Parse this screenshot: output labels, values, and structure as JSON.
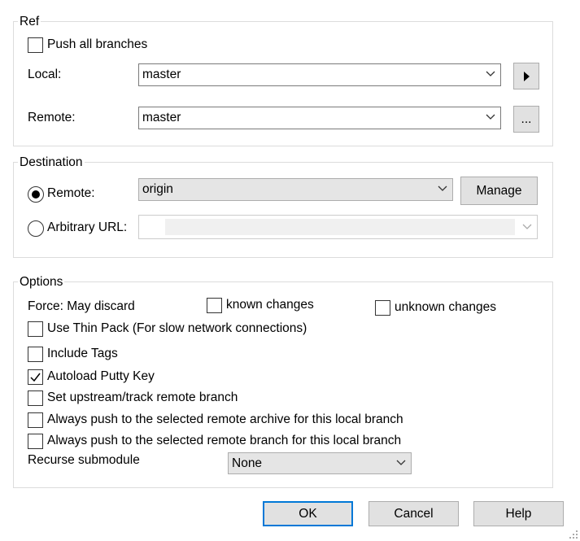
{
  "ref": {
    "legend": "Ref",
    "push_all_branches": {
      "label": "Push all branches",
      "checked": false
    },
    "local": {
      "label": "Local:",
      "value": "master",
      "button_icon": "play-triangle-icon"
    },
    "remote": {
      "label": "Remote:",
      "value": "master",
      "button_label": "..."
    }
  },
  "destination": {
    "legend": "Destination",
    "remote": {
      "label": "Remote:",
      "value": "origin",
      "selected": true
    },
    "manage_label": "Manage",
    "arbitrary_url": {
      "label": "Arbitrary URL:",
      "value": "",
      "selected": false
    }
  },
  "options": {
    "legend": "Options",
    "force_label": "Force: May discard",
    "known_changes": {
      "label": "known changes",
      "checked": false
    },
    "unknown_changes": {
      "label": "unknown changes",
      "checked": false
    },
    "use_thin_pack": {
      "label": "Use Thin Pack (For slow network connections)",
      "checked": false
    },
    "include_tags": {
      "label": "Include Tags",
      "checked": false
    },
    "autoload_putty_key": {
      "label": "Autoload Putty Key",
      "checked": true
    },
    "set_upstream": {
      "label": "Set upstream/track remote branch",
      "checked": false
    },
    "always_push_archive": {
      "label": "Always push to the selected remote archive for this local branch",
      "checked": false
    },
    "always_push_branch": {
      "label": "Always push to the selected remote branch for this local branch",
      "checked": false
    },
    "recurse_submodule": {
      "label": "Recurse submodule",
      "value": "None"
    }
  },
  "buttons": {
    "ok": "OK",
    "cancel": "Cancel",
    "help": "Help"
  },
  "colors": {
    "accent": "#0078d7",
    "button_face": "#e1e1e1",
    "group_border": "#dcdcdc"
  }
}
